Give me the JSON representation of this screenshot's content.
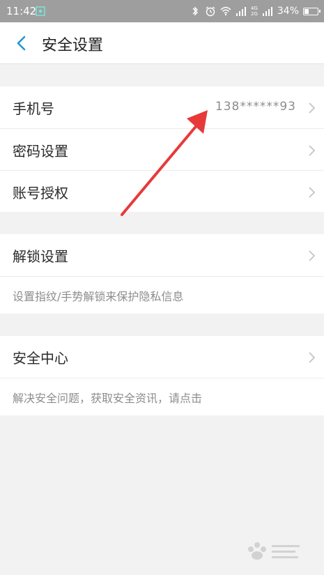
{
  "status_bar": {
    "time": "11:42",
    "network_top": "4G",
    "network_bottom": "2G",
    "battery_percent": "34%",
    "battery_level": 0.34,
    "icons": [
      "screenshot-icon",
      "bluetooth-icon",
      "alarm-icon",
      "wifi-icon",
      "signal-icon",
      "battery-icon"
    ]
  },
  "header": {
    "back_icon": "back-chevron-icon",
    "title": "安全设置"
  },
  "groups": {
    "account": {
      "phone": {
        "label": "手机号",
        "value": "138******93"
      },
      "password": {
        "label": "密码设置"
      },
      "authorization": {
        "label": "账号授权"
      }
    },
    "unlock": {
      "label": "解锁设置",
      "hint": "设置指纹/手势解锁来保护隐私信息"
    },
    "security_center": {
      "label": "安全中心",
      "hint": "解决安全问题，获取安全资讯，请点击"
    }
  },
  "colors": {
    "status_bar_bg": "#9e9e9e",
    "accent_blue": "#2196d3",
    "arrow_red": "#e8393a",
    "page_bg": "#f2f2f2"
  }
}
